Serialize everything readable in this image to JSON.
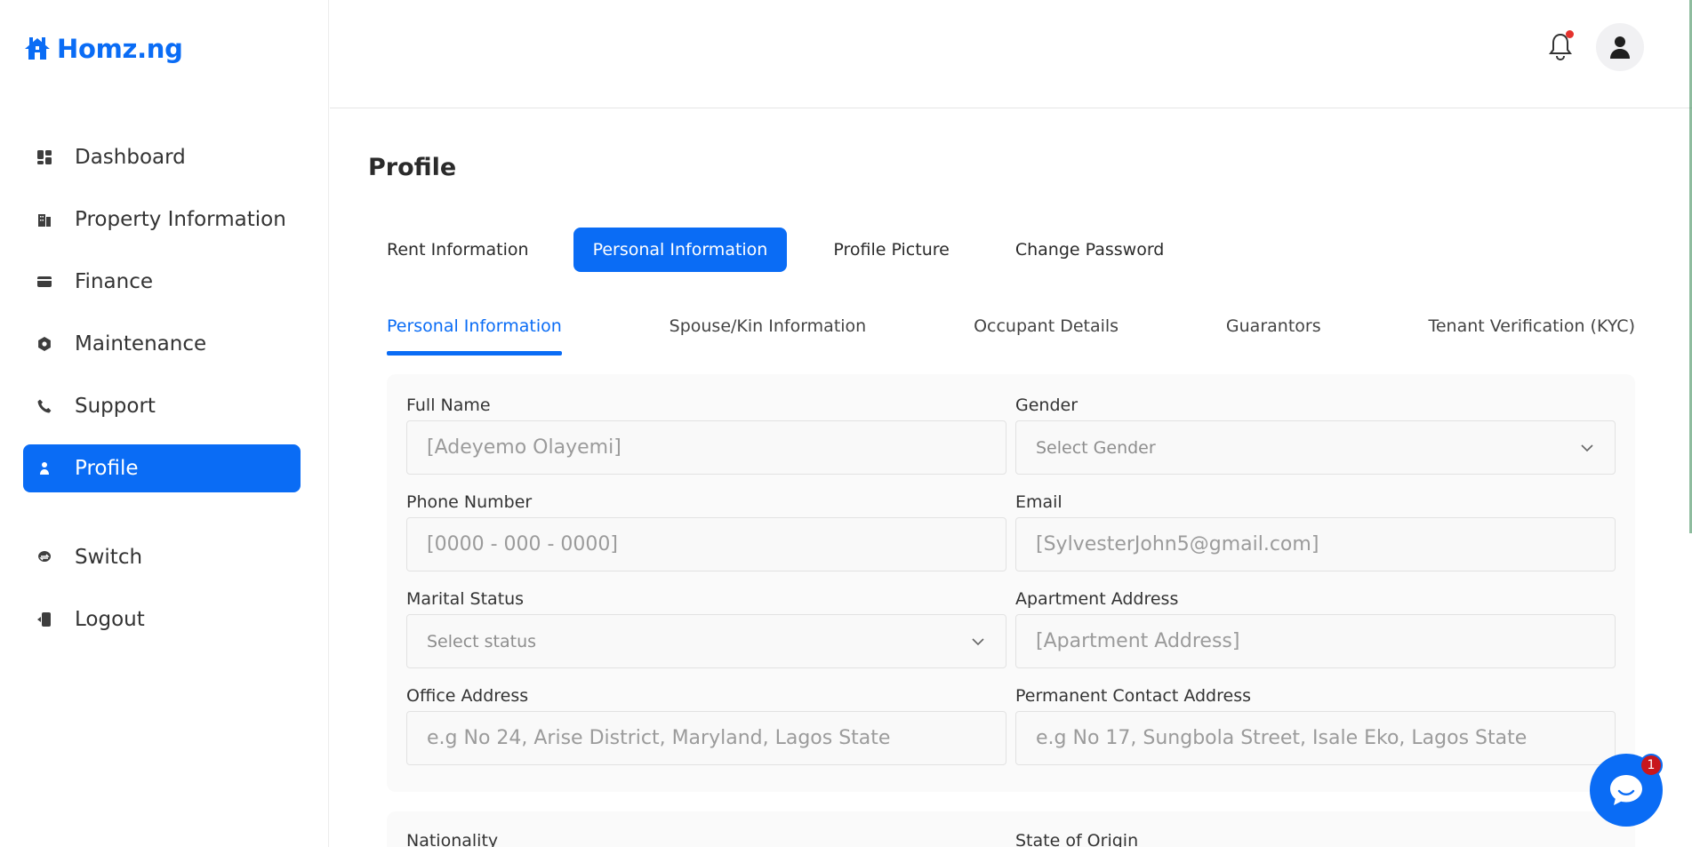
{
  "brand": {
    "name": "Homz.ng",
    "color": "#0a6cf5"
  },
  "sidebar": {
    "items": [
      {
        "label": "Dashboard",
        "icon": "dashboard-icon"
      },
      {
        "label": "Property Information",
        "icon": "building-icon"
      },
      {
        "label": "Finance",
        "icon": "wallet-icon"
      },
      {
        "label": "Maintenance",
        "icon": "gear-icon"
      },
      {
        "label": "Support",
        "icon": "phone-icon"
      },
      {
        "label": "Profile",
        "icon": "user-icon",
        "active": true
      }
    ],
    "bottom_items": [
      {
        "label": "Switch",
        "icon": "switch-icon"
      },
      {
        "label": "Logout",
        "icon": "logout-icon"
      }
    ]
  },
  "header": {
    "notification_icon": "bell-icon",
    "avatar_icon": "user-avatar-icon"
  },
  "page": {
    "title": "Profile"
  },
  "tabs": [
    {
      "label": "Rent Information"
    },
    {
      "label": "Personal Information",
      "active": true
    },
    {
      "label": "Profile Picture"
    },
    {
      "label": "Change Password"
    }
  ],
  "subtabs": [
    {
      "label": "Personal Information",
      "active": true
    },
    {
      "label": "Spouse/Kin Information"
    },
    {
      "label": "Occupant Details"
    },
    {
      "label": "Guarantors"
    },
    {
      "label": "Tenant Verification (KYC)"
    }
  ],
  "form": {
    "full_name": {
      "label": "Full Name",
      "placeholder": "[Adeyemo Olayemi]"
    },
    "gender": {
      "label": "Gender",
      "placeholder": "Select Gender"
    },
    "phone": {
      "label": "Phone Number",
      "placeholder": "[0000 - 000 - 0000]"
    },
    "email": {
      "label": "Email",
      "placeholder": "[SylvesterJohn5@gmail.com]"
    },
    "marital": {
      "label": "Marital Status",
      "placeholder": "Select status"
    },
    "apartment": {
      "label": "Apartment Address",
      "placeholder": "[Apartment Address]"
    },
    "office": {
      "label": "Office Address",
      "placeholder": "e.g No 24, Arise District, Maryland, Lagos State"
    },
    "permanent": {
      "label": "Permanent Contact Address",
      "placeholder": "e.g No 17, Sungbola Street, Isale Eko, Lagos State"
    },
    "nationality": {
      "label": "Nationality"
    },
    "state_origin": {
      "label": "State of Origin"
    }
  },
  "chat": {
    "badge": "1",
    "icon": "chat-icon"
  }
}
